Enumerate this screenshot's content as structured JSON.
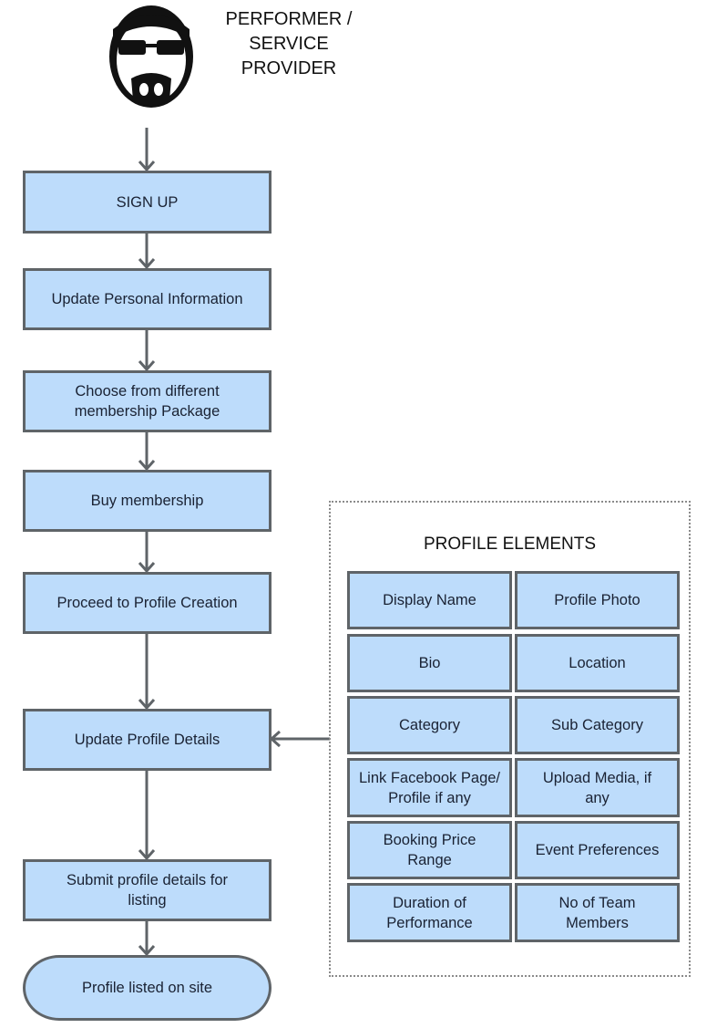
{
  "header": {
    "actor_icon": "performer-face-icon",
    "title_line1": "PERFORMER /",
    "title_line2": "SERVICE PROVIDER"
  },
  "flow": {
    "steps": [
      {
        "label": "SIGN UP"
      },
      {
        "label": "Update Personal Information"
      },
      {
        "label": "Choose from different membership Package"
      },
      {
        "label": "Buy membership"
      },
      {
        "label": "Proceed to Profile Creation"
      },
      {
        "label": "Update Profile Details"
      },
      {
        "label": "Submit profile details for listing"
      }
    ],
    "end": {
      "label": "Profile listed on site"
    }
  },
  "profile_elements": {
    "title": "PROFILE ELEMENTS",
    "items": [
      "Display Name",
      "Profile Photo",
      "Bio",
      "Location",
      "Category",
      "Sub Category",
      "Link Facebook Page/ Profile if any",
      "Upload Media, if any",
      "Booking Price Range",
      "Event Preferences",
      "Duration of Performance",
      "No of Team Members"
    ]
  },
  "colors": {
    "box_fill": "#bddcfb",
    "box_border": "#5f6468",
    "connector": "#5f6468"
  }
}
